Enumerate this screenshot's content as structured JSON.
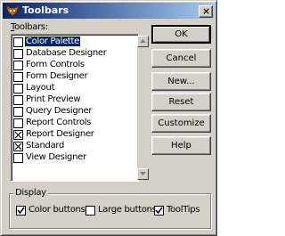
{
  "window": {
    "title": "Toolbars"
  },
  "toolbars_label": "Toolbars:",
  "toolbars_label_access_key": "T",
  "toolbars_label_rest": "oolbars:",
  "list_items": [
    {
      "label": "Color Palette",
      "checked": false,
      "selected": true
    },
    {
      "label": "Database Designer",
      "checked": false
    },
    {
      "label": "Form Controls",
      "checked": false
    },
    {
      "label": "Form Designer",
      "checked": false
    },
    {
      "label": "Layout",
      "checked": false
    },
    {
      "label": "Print Preview",
      "checked": false
    },
    {
      "label": "Query Designer",
      "checked": false
    },
    {
      "label": "Report Controls",
      "checked": false
    },
    {
      "label": "Report Designer",
      "checked": true
    },
    {
      "label": "Standard",
      "checked": true
    },
    {
      "label": "View Designer",
      "checked": false
    }
  ],
  "buttons": {
    "ok": "OK",
    "cancel": "Cancel",
    "new": "New...",
    "reset": "Reset",
    "customize": "Customize",
    "help": "Help"
  },
  "display": {
    "label": "Display",
    "color_buttons": {
      "label": "Color buttons",
      "checked": true
    },
    "large_buttons": {
      "label": "Large buttons",
      "checked": false
    },
    "tooltips": {
      "label": "ToolTips",
      "checked": true
    }
  }
}
